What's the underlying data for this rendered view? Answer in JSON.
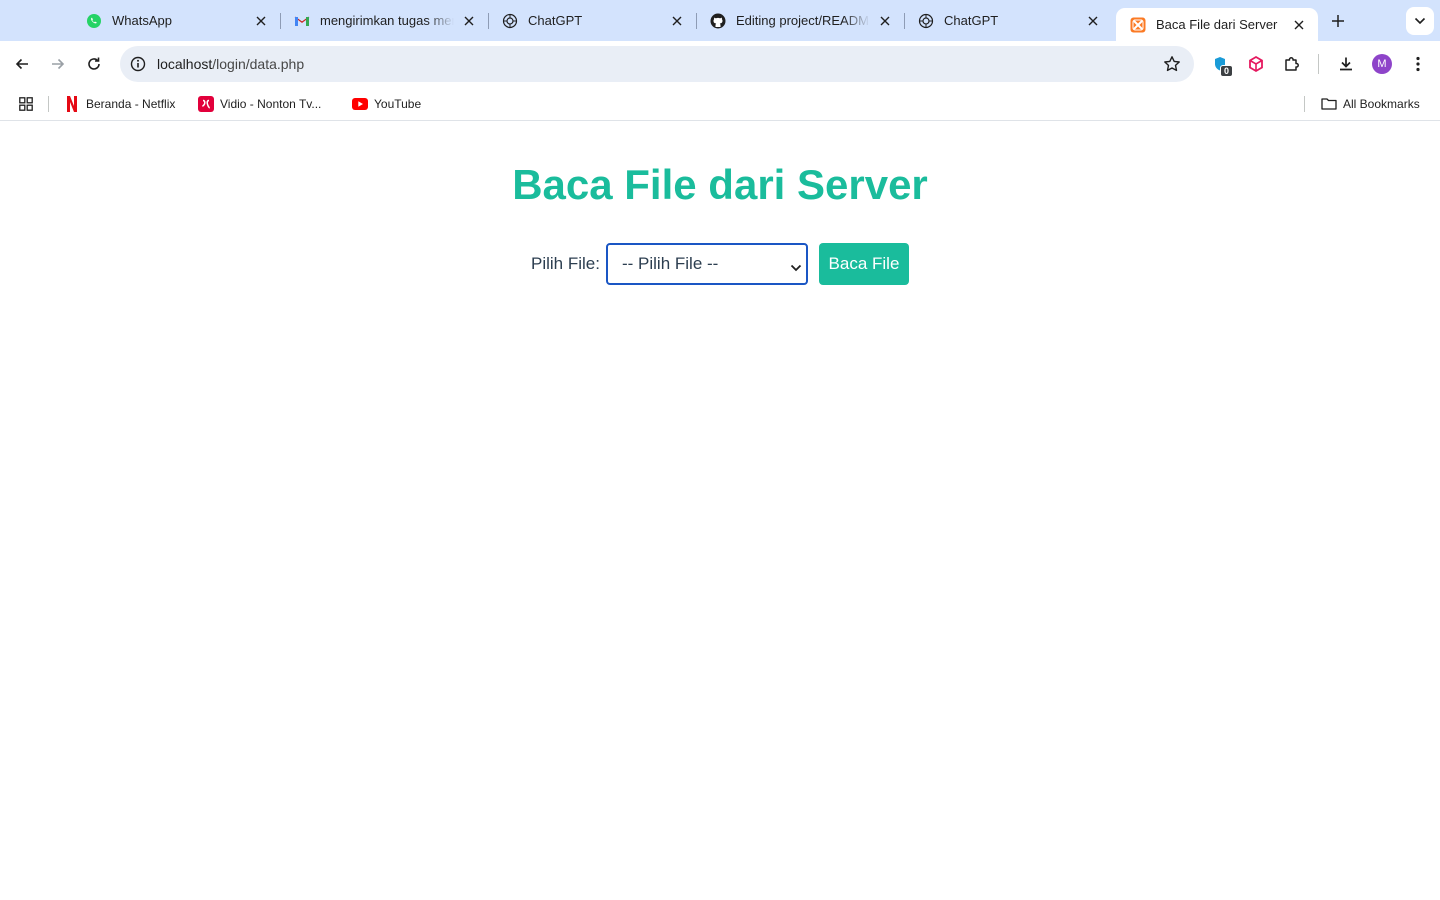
{
  "browser": {
    "tabs": [
      {
        "title": "WhatsApp",
        "icon": "whatsapp-icon",
        "active": false
      },
      {
        "title": "mengirimkan tugas men",
        "icon": "gmail-icon",
        "active": false
      },
      {
        "title": "ChatGPT",
        "icon": "chatgpt-icon",
        "active": false
      },
      {
        "title": "Editing project/README",
        "icon": "github-icon",
        "active": false
      },
      {
        "title": "ChatGPT",
        "icon": "chatgpt-icon",
        "active": false
      },
      {
        "title": "Baca File dari Server",
        "icon": "xampp-icon",
        "active": true
      }
    ],
    "address": {
      "host": "localhost",
      "path": "/login/data.php"
    },
    "extension_badge": "0",
    "profile_initial": "M",
    "bookmarks": [
      {
        "label": "Beranda - Netflix",
        "icon": "netflix-icon"
      },
      {
        "label": "Vidio - Nonton Tv...",
        "icon": "vidio-icon"
      },
      {
        "label": "YouTube",
        "icon": "youtube-icon"
      }
    ],
    "all_bookmarks_label": "All Bookmarks"
  },
  "page": {
    "heading": "Baca File dari Server",
    "form": {
      "label": "Pilih File:",
      "select_value": "-- Pilih File --",
      "button_label": "Baca File"
    }
  },
  "colors": {
    "accent": "#1abc9c",
    "text": "#2c3e50",
    "tabstrip": "#d3e3fd",
    "omnibox": "#e9eef6",
    "select_focus": "#1a56c4"
  }
}
